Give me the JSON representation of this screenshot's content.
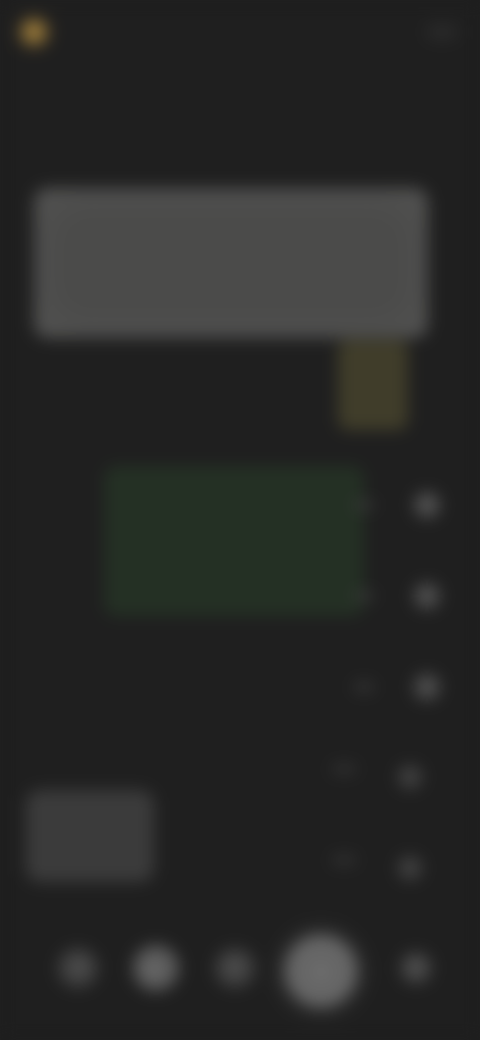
{
  "header": {
    "app_name": "",
    "logo_icon": "app-logo-icon",
    "top_action_label": ""
  },
  "intro": {
    "subtitle": ""
  },
  "hero": {
    "title": ""
  },
  "rows": [
    {
      "label": "",
      "icon": "settings-icon"
    },
    {
      "label": "",
      "icon": "toggle-icon"
    },
    {
      "label": "",
      "icon": "info-icon"
    }
  ],
  "lower": {
    "labels": [
      ""
    ],
    "icons": [
      "chevron-right-icon",
      "chevron-right-icon"
    ]
  },
  "controls": {
    "icons": [
      "back-icon",
      "play-icon",
      "forward-icon",
      "record-icon",
      "menu-icon"
    ]
  },
  "colors": {
    "background": "#1f1f1f",
    "accent_gold": "#9a7a3a",
    "accent_green": "#243024"
  }
}
